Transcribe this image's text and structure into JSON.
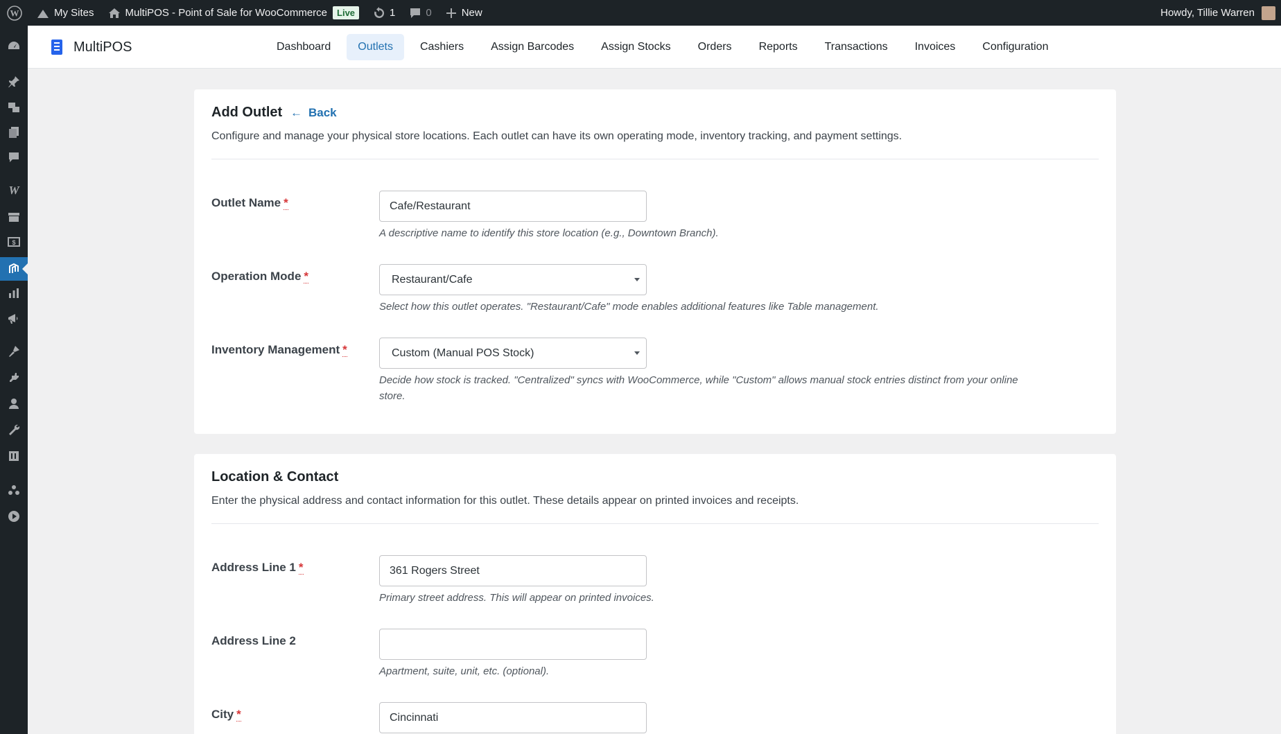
{
  "admin_bar": {
    "my_sites": "My Sites",
    "site_name": "MultiPOS - Point of Sale for WooCommerce",
    "live_badge": "Live",
    "updates_count": "1",
    "comments_count": "0",
    "new_label": "New",
    "greeting": "Howdy, Tillie Warren"
  },
  "brand": {
    "name": "MultiPOS"
  },
  "nav": {
    "items": [
      {
        "label": "Dashboard"
      },
      {
        "label": "Outlets"
      },
      {
        "label": "Cashiers"
      },
      {
        "label": "Assign Barcodes"
      },
      {
        "label": "Assign Stocks"
      },
      {
        "label": "Orders"
      },
      {
        "label": "Reports"
      },
      {
        "label": "Transactions"
      },
      {
        "label": "Invoices"
      },
      {
        "label": "Configuration"
      }
    ],
    "active": "Outlets"
  },
  "section1": {
    "title": "Add Outlet",
    "back_label": "Back",
    "description": "Configure and manage your physical store locations. Each outlet can have its own operating mode, inventory tracking, and payment settings."
  },
  "fields": {
    "outlet_name": {
      "label": "Outlet Name",
      "value": "Cafe/Restaurant",
      "help": "A descriptive name to identify this store location (e.g., Downtown Branch)."
    },
    "operation_mode": {
      "label": "Operation Mode",
      "value": "Restaurant/Cafe",
      "help": "Select how this outlet operates. \"Restaurant/Cafe\" mode enables additional features like Table management."
    },
    "inventory_management": {
      "label": "Inventory Management",
      "value": "Custom (Manual POS Stock)",
      "help_line1": "Decide how stock is tracked. \"Centralized\" syncs with WooCommerce, while \"Custom\" allows manual stock entries distinct from your online",
      "help_line2": "store."
    },
    "address_line_1": {
      "label": "Address Line 1",
      "value": "361 Rogers Street",
      "help": "Primary street address. This will appear on printed invoices."
    },
    "address_line_2": {
      "label": "Address Line 2",
      "value": "",
      "help": "Apartment, suite, unit, etc. (optional)."
    },
    "city": {
      "label": "City",
      "value": "Cincinnati"
    }
  },
  "section2": {
    "title": "Location & Contact",
    "description": "Enter the physical address and contact information for this outlet. These details appear on printed invoices and receipts."
  },
  "required_marker": "*",
  "colors": {
    "accent": "#2271b1",
    "admin_bar_bg": "#1d2327",
    "required": "#d63638"
  }
}
